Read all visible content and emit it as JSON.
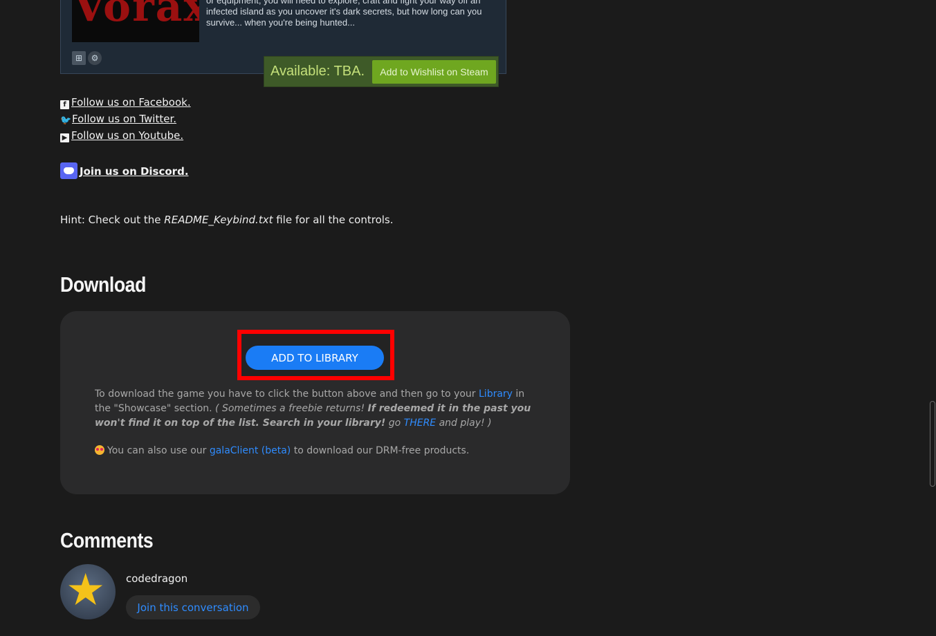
{
  "steam": {
    "capsule_text": "Vorax",
    "description": "Vorax is an atmospheric open world survival horror. Alone, with no food or equipment, you will need to explore, craft and fight your way off an infected island as you uncover it's dark secrets, but how long can you survive... when you're being hunted...",
    "platforms": [
      "windows-icon",
      "steam-icon"
    ],
    "availability": "Available: TBA.",
    "wishlist_label": "Add to Wishlist on Steam"
  },
  "social": {
    "facebook": "Follow us on Facebook.",
    "twitter": "Follow us on Twitter.",
    "youtube": "Follow us on Youtube.",
    "discord": "Join us on Discord."
  },
  "hint": {
    "prefix": "Hint: Check out the ",
    "file": "README_Keybind.txt",
    "suffix": " file for all the controls."
  },
  "download": {
    "title": "Download",
    "button_label": "ADD TO LIBRARY",
    "text_1": "To download the game you have to click the button above and then go to your ",
    "library_link": "Library",
    "text_2": " in the \"Showcase\" section. ",
    "italic_1": "( Sometimes a freebie returns! ",
    "bold_italic": "If redeemed it in the past you won't find it on top of the list. Search in your library!",
    "italic_2": " go ",
    "there_link": "THERE",
    "italic_3": " and play! )",
    "client_prefix": "You can also use our ",
    "client_link": "galaClient (beta)",
    "client_suffix": " to download our DRM-free products."
  },
  "comments": {
    "title": "Comments",
    "username": "codedragon",
    "join_label": "Join this conversation"
  },
  "colors": {
    "accent_blue": "#1a7cf5",
    "link_blue": "#2f8cff",
    "highlight_red": "#ff0000",
    "steam_green": "#6fa720"
  }
}
